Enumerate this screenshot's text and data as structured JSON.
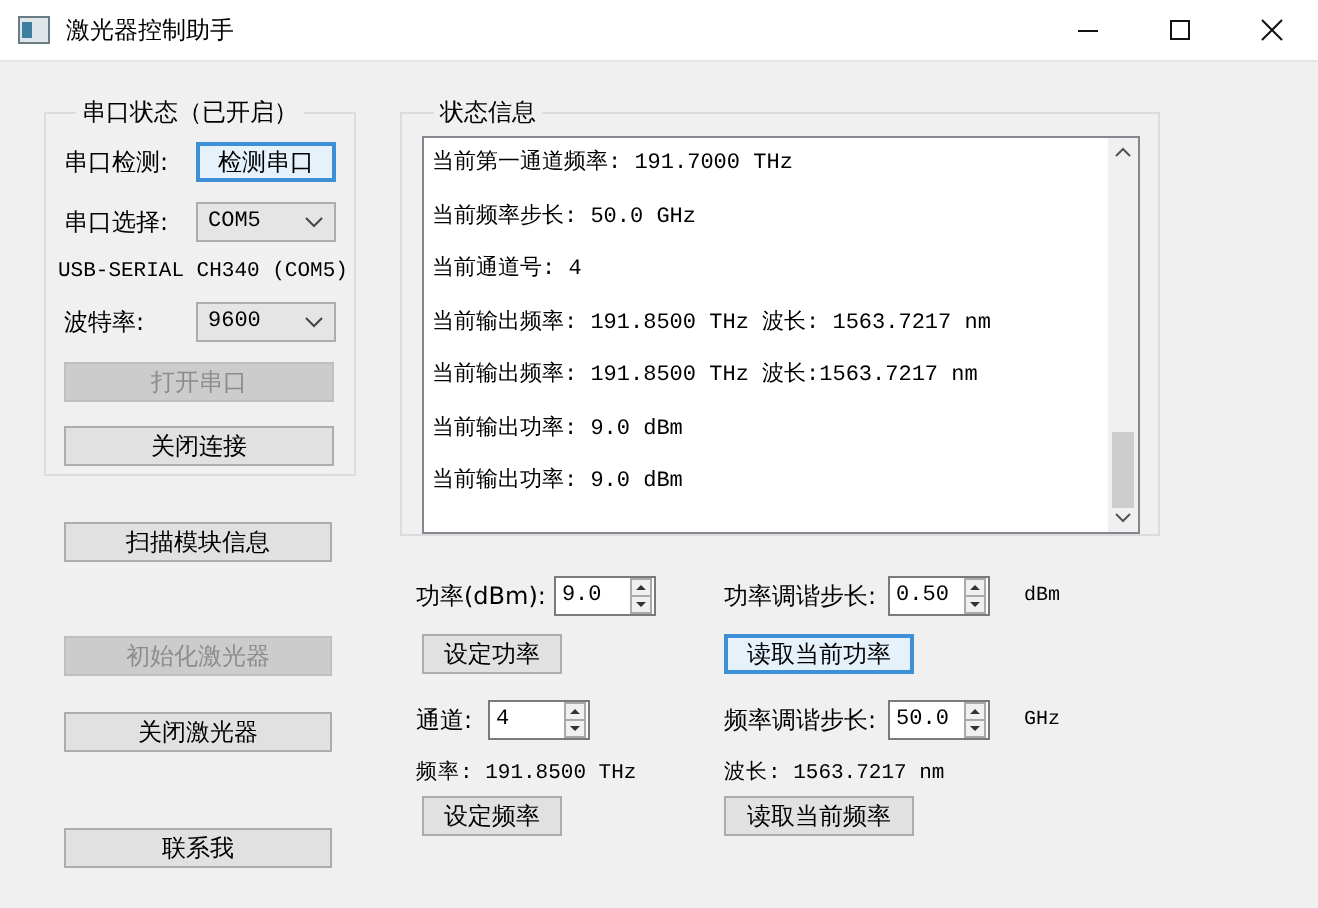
{
  "window": {
    "title": "激光器控制助手"
  },
  "serial_group": {
    "title": "串口状态（已开启）",
    "detect_label": "串口检测:",
    "detect_button": {
      "label": "检测串口",
      "disabled": false,
      "focused": true
    },
    "port_label": "串口选择:",
    "port_select": {
      "value": "COM5"
    },
    "device_text": "USB-SERIAL CH340 (COM5)",
    "baud_label": "波特率:",
    "baud_select": {
      "value": "9600"
    },
    "open_button": {
      "label": "打开串口",
      "disabled": true,
      "focused": false
    },
    "close_button": {
      "label": "关闭连接",
      "disabled": false,
      "focused": false
    }
  },
  "left_buttons": [
    {
      "label": "扫描模块信息",
      "disabled": false,
      "focused": false
    },
    {
      "label": "初始化激光器",
      "disabled": true,
      "focused": false
    },
    {
      "label": "关闭激光器",
      "disabled": false,
      "focused": false
    },
    {
      "label": "联系我",
      "disabled": false,
      "focused": false
    }
  ],
  "status_group": {
    "title": "状态信息",
    "lines": [
      "当前第一通道频率: 191.7000 THz",
      "当前频率步长: 50.0 GHz",
      "当前通道号: 4",
      "当前输出频率: 191.8500 THz  波长: 1563.7217 nm",
      "当前输出频率: 191.8500 THz  波长:1563.7217 nm",
      "当前输出功率: 9.0 dBm",
      "当前输出功率: 9.0 dBm"
    ]
  },
  "controls": {
    "power_label": "功率(dBm):",
    "power_value": "9.0",
    "power_step_label": "功率调谐步长:",
    "power_step_value": "0.50",
    "power_unit": "dBm",
    "set_power_button": {
      "label": "设定功率",
      "disabled": false,
      "focused": false
    },
    "read_power_button": {
      "label": "读取当前功率",
      "disabled": false,
      "focused": true
    },
    "channel_label": "通道:",
    "channel_value": "4",
    "freq_step_label": "频率调谐步长:",
    "freq_step_value": "50.0",
    "freq_unit": "GHz",
    "frequency_text": "频率: 191.8500 THz",
    "wavelength_text": "波长: 1563.7217 nm",
    "set_freq_button": {
      "label": "设定频率",
      "disabled": false,
      "focused": false
    },
    "read_freq_button": {
      "label": "读取当前频率",
      "disabled": false,
      "focused": false
    }
  }
}
